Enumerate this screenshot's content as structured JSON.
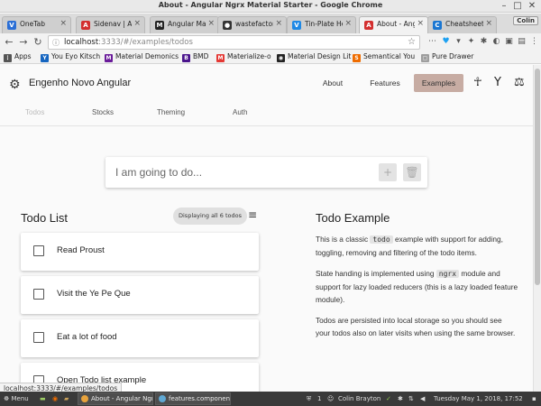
{
  "window": {
    "title": "About - Angular Ngrx Material Starter - Google Chrome"
  },
  "tabs": [
    {
      "label": "OneTab",
      "icon": "onetab-icon",
      "color": "#2b6fd6",
      "glyph": "V",
      "active": false
    },
    {
      "label": "Sidenav | Angular",
      "icon": "angular-icon",
      "color": "#d32f2f",
      "glyph": "A",
      "active": false
    },
    {
      "label": "Angular Material",
      "icon": "medium-icon",
      "color": "#222222",
      "glyph": "M",
      "active": false
    },
    {
      "label": "wastefactor",
      "icon": "github-icon",
      "color": "#333333",
      "glyph": "●",
      "active": false
    },
    {
      "label": "Tin-Plate Heroes",
      "icon": "tinplate-icon",
      "color": "#1e88e5",
      "glyph": "V",
      "active": false
    },
    {
      "label": "About - Angular",
      "icon": "angular-icon",
      "color": "#d32f2f",
      "glyph": "A",
      "active": true
    },
    {
      "label": "Cheatsheet",
      "icon": "cheatsheet-icon",
      "color": "#1976d2",
      "glyph": "C",
      "active": false
    }
  ],
  "profile": "Colin",
  "address": {
    "host": "localhost",
    "path": ":3333/#/examples/todos"
  },
  "bookmarks": [
    {
      "label": "Apps",
      "icon": "apps-icon",
      "color": "#555555",
      "glyph": "⋮"
    },
    {
      "label": "You Eyo Kitsch",
      "icon": "bookmark-icon",
      "color": "#1565c0",
      "glyph": "Y"
    },
    {
      "label": "Material Demonics",
      "icon": "bookmark-icon",
      "color": "#6a1b9a",
      "glyph": "M"
    },
    {
      "label": "BMD",
      "icon": "bookmark-icon",
      "color": "#4a148c",
      "glyph": "B"
    },
    {
      "label": "Materialize-o",
      "icon": "bookmark-icon",
      "color": "#e53935",
      "glyph": "M"
    },
    {
      "label": "Material Design Lit",
      "icon": "bookmark-icon",
      "color": "#222222",
      "glyph": "◉"
    },
    {
      "label": "Semantical You",
      "icon": "bookmark-icon",
      "color": "#ef6c00",
      "glyph": "S"
    },
    {
      "label": "Pure Drawer",
      "icon": "page-icon",
      "color": "#9e9e9e",
      "glyph": "▢"
    }
  ],
  "app": {
    "brand": "Engenho Novo Angular",
    "nav": [
      {
        "label": "About",
        "active": false
      },
      {
        "label": "Features",
        "active": false
      },
      {
        "label": "Examples",
        "active": true
      }
    ],
    "subnav": [
      {
        "label": "Todos",
        "active": true
      },
      {
        "label": "Stocks",
        "active": false
      },
      {
        "label": "Theming",
        "active": false
      },
      {
        "label": "Auth",
        "active": false
      }
    ],
    "accent": "#c7aca3"
  },
  "todo": {
    "placeholder": "I am going to do...",
    "list_title": "Todo List",
    "count_label": "Displaying all 6 todos",
    "items": [
      {
        "label": "Read Proust",
        "done": false
      },
      {
        "label": "Visit the Ye Pe Que",
        "done": false
      },
      {
        "label": "Eat a lot of food",
        "done": false
      },
      {
        "label": "Open Todo list example",
        "done": false
      }
    ]
  },
  "example": {
    "title": "Todo Example",
    "p1": {
      "a": "This is a classic",
      "code": "todo",
      "b": "example with support for adding, toggling, removing and filtering of the todo items."
    },
    "p2": {
      "a": "State handing is implemented using",
      "code": "ngrx",
      "b": "module and support for lazy loaded reducers (this is a lazy loaded feature module)."
    },
    "p3": "Todos are persisted into local storage so you should see your todos also on later visits when using the same browser."
  },
  "status_url": "localhost:3333/#/examples/todos",
  "taskbar": {
    "menu": "Menu",
    "windows": [
      {
        "label": "About - Angular Ngr...",
        "color": "#e8a33c"
      },
      {
        "label": "features.component...",
        "color": "#5fa8d3"
      }
    ],
    "badge": "1",
    "user": "Colin Brayton",
    "clock": "Tuesday May 1, 2018, 17:52"
  }
}
